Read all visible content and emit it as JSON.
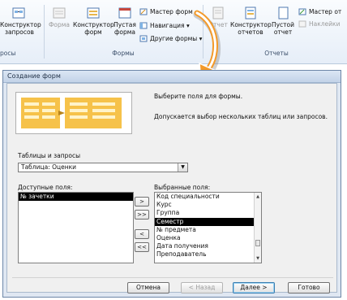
{
  "ribbon": {
    "query_designer": "Конструктор\nзапросов",
    "query_group_fragment": "росы",
    "form_btn": "Форма",
    "form_designer": "Конструктор\nформ",
    "blank_form": "Пустая\nформа",
    "form_wizard": "Мастер форм",
    "navigation": "Навигация",
    "more_forms": "Другие формы",
    "forms_group": "Формы",
    "report": "Отчет",
    "report_designer": "Конструктор\nотчетов",
    "blank_report": "Пустой\nотчет",
    "report_wizard": "Мастер от",
    "labels": "Наклейки",
    "reports_group": "Отчеты"
  },
  "dialog": {
    "title": "Создание форм",
    "intro": "Выберите поля для формы.",
    "hint": "Допускается выбор нескольких таблиц или запросов.",
    "tables_label": "Таблицы и запросы",
    "tables_value": "Таблица: Оценки",
    "available_label": "Доступные поля:",
    "available_fields": [
      "№ зачетки"
    ],
    "selected_label": "Выбранные поля:",
    "selected_fields": [
      "Код специальности",
      "Курс",
      "Группа",
      "Семестр",
      "№ предмета",
      "Оценка",
      "Дата получения",
      "Преподаватель"
    ],
    "selected_index": 3,
    "btn_add_one": ">",
    "btn_add_all": ">>",
    "btn_remove_one": "<",
    "btn_remove_all": "<<",
    "cancel": "Отмена",
    "back": "< Назад",
    "next": "Далее >",
    "finish": "Готово"
  },
  "colors": {
    "ribbon_bg": "#e6eef8",
    "dialog_frame": "#dfe7f2",
    "selection": "#000000",
    "arrow_orange": "#f39a2a"
  }
}
